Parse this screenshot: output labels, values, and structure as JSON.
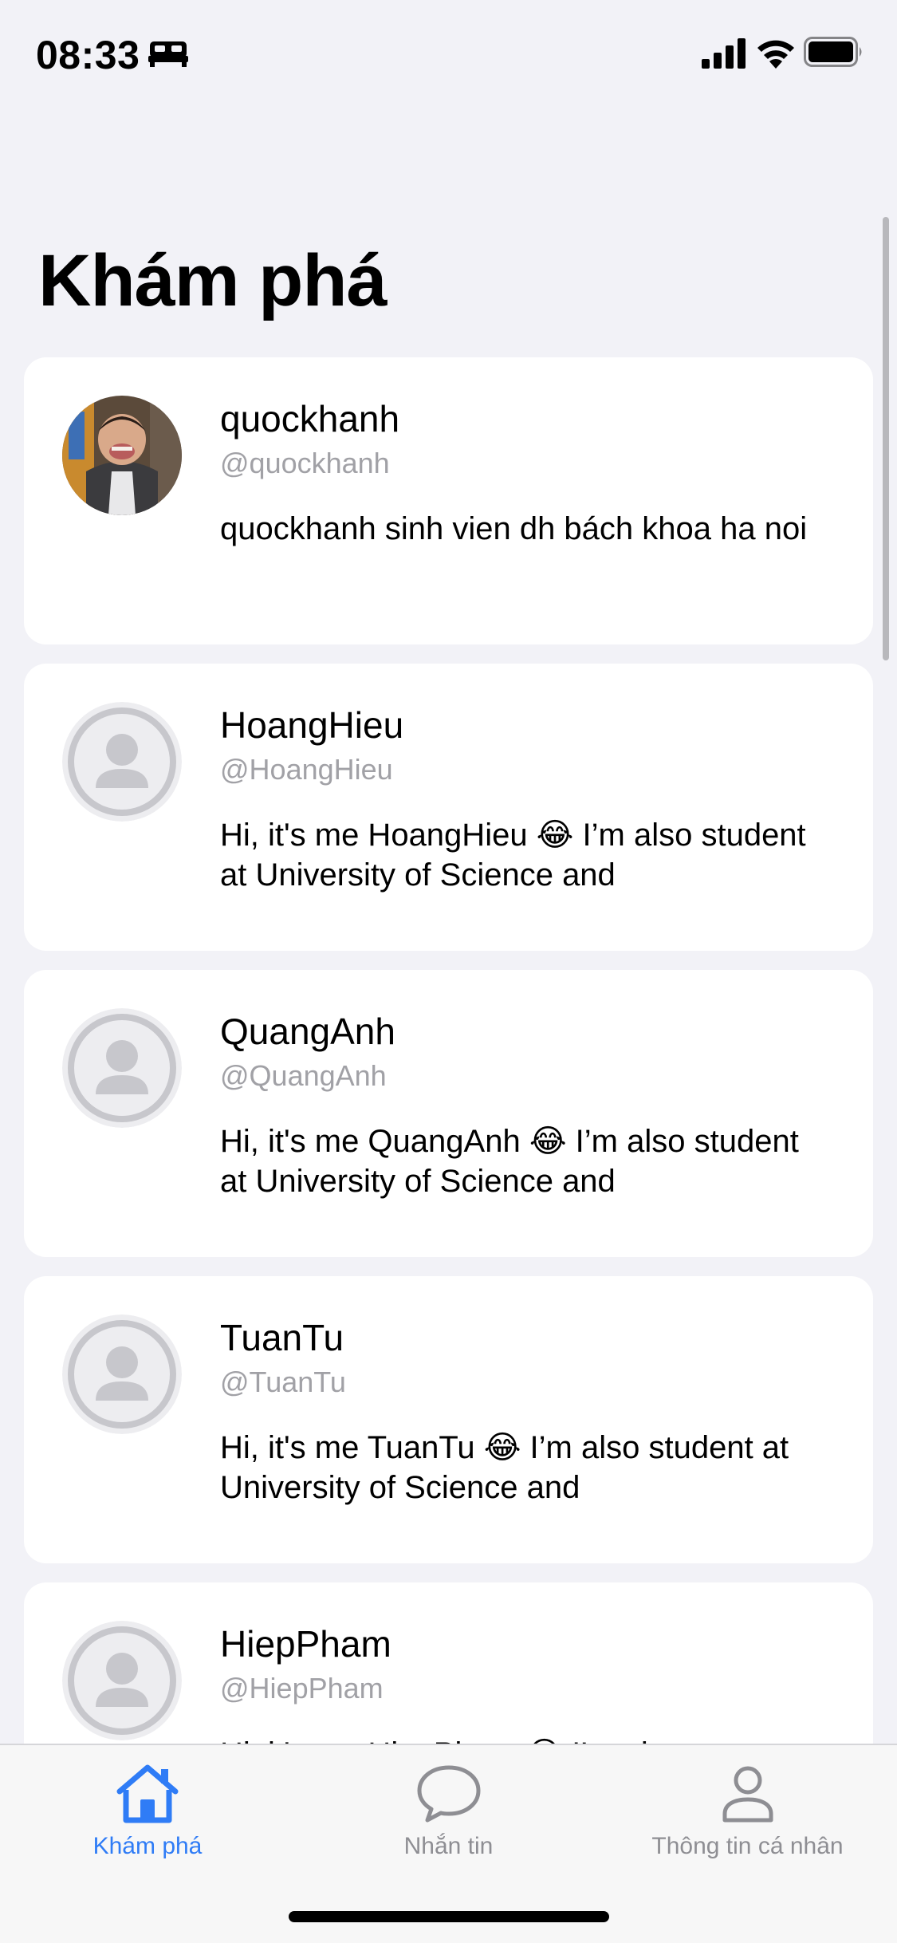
{
  "status_bar": {
    "time": "08:33",
    "focus_icon": "bed-icon",
    "signal_icon": "cellular-signal-icon",
    "wifi_icon": "wifi-icon",
    "battery_icon": "battery-icon"
  },
  "header": {
    "title": "Khám phá"
  },
  "feed": {
    "users": [
      {
        "display_name": "quockhanh",
        "username": "@quockhanh",
        "bio": "quockhanh sinh vien dh bách khoa ha noi",
        "avatar": "photo"
      },
      {
        "display_name": "HoangHieu",
        "username": "@HoangHieu",
        "bio": "Hi, it's me HoangHieu 😂 I’m also student at  University of Science and",
        "avatar": "placeholder-person-icon"
      },
      {
        "display_name": "QuangAnh",
        "username": "@QuangAnh",
        "bio": "Hi, it's me QuangAnh 😂 I’m also student at  University of Science and",
        "avatar": "placeholder-person-icon"
      },
      {
        "display_name": "TuanTu",
        "username": "@TuanTu",
        "bio": "Hi, it's me TuanTu 😂 I’m also student at  University of Science and",
        "avatar": "placeholder-person-icon"
      },
      {
        "display_name": "HiepPham",
        "username": "@HiepPham",
        "bio": "Hi, it's me HiepPham 😂 I’m also",
        "avatar": "placeholder-person-icon"
      }
    ]
  },
  "tab_bar": {
    "tabs": [
      {
        "label": "Khám phá",
        "icon": "house-icon",
        "active": true
      },
      {
        "label": "Nhắn tin",
        "icon": "chat-bubble-icon",
        "active": false
      },
      {
        "label": "Thông tin cá nhân",
        "icon": "person-icon",
        "active": false
      }
    ]
  },
  "colors": {
    "accent": "#2F7CF6",
    "background": "#F2F2F7",
    "card": "#FFFFFF",
    "secondary_text": "#A1A1A6",
    "inactive_tab": "#8E8E93"
  }
}
